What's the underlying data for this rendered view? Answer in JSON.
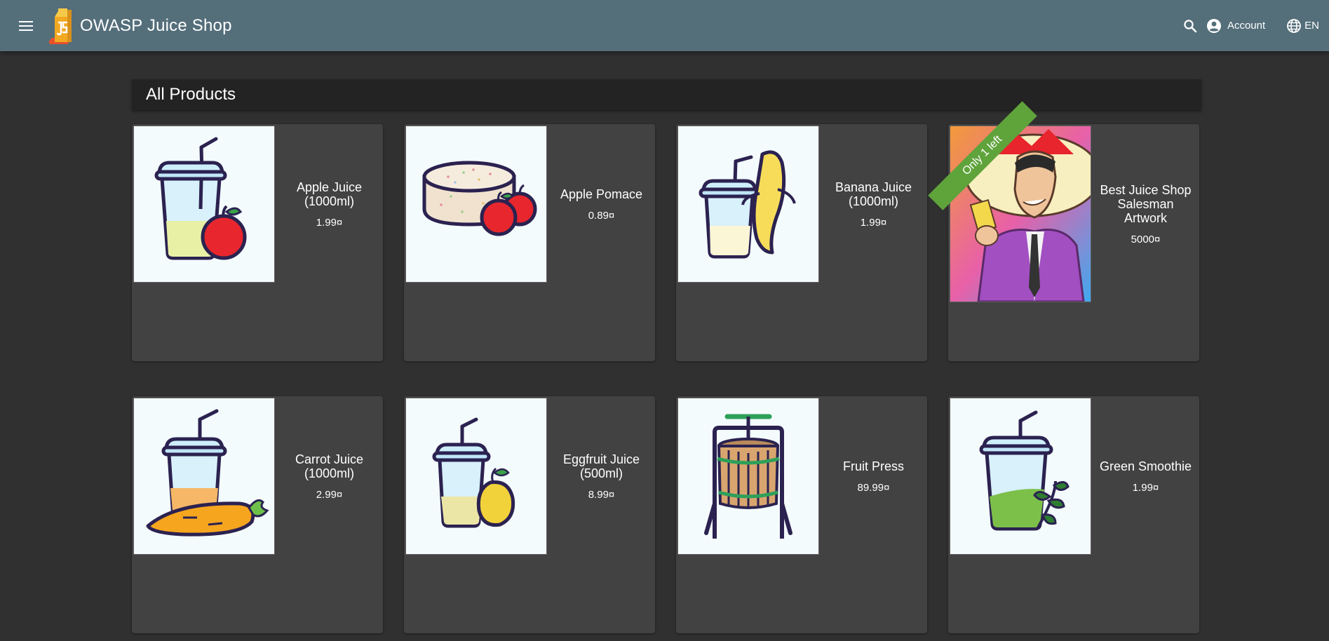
{
  "app": {
    "title": "OWASP Juice Shop"
  },
  "toolbar": {
    "account_label": "Account",
    "language_label": "EN"
  },
  "page": {
    "heading": "All Products"
  },
  "products": [
    {
      "name": "Apple Juice (1000ml)",
      "price": "1.99¤",
      "image_icon": "apple-juice-icon"
    },
    {
      "name": "Apple Pomace",
      "price": "0.89¤",
      "image_icon": "apple-pomace-icon"
    },
    {
      "name": "Banana Juice (1000ml)",
      "price": "1.99¤",
      "image_icon": "banana-juice-icon"
    },
    {
      "name": "Best Juice Shop Salesman Artwork",
      "price": "5000¤",
      "badge": "Only 1 left",
      "image_icon": "salesman-artwork-image"
    },
    {
      "name": "Carrot Juice (1000ml)",
      "price": "2.99¤",
      "image_icon": "carrot-juice-icon"
    },
    {
      "name": "Eggfruit Juice (500ml)",
      "price": "8.99¤",
      "image_icon": "eggfruit-juice-icon"
    },
    {
      "name": "Fruit Press",
      "price": "89.99¤",
      "image_icon": "fruit-press-icon"
    },
    {
      "name": "Green Smoothie",
      "price": "1.99¤",
      "image_icon": "green-smoothie-icon"
    }
  ],
  "colors": {
    "toolbar": "#546e7a",
    "background": "#303030",
    "card": "#424242",
    "heading_bar": "#232323",
    "badge": "#5fa33b"
  }
}
